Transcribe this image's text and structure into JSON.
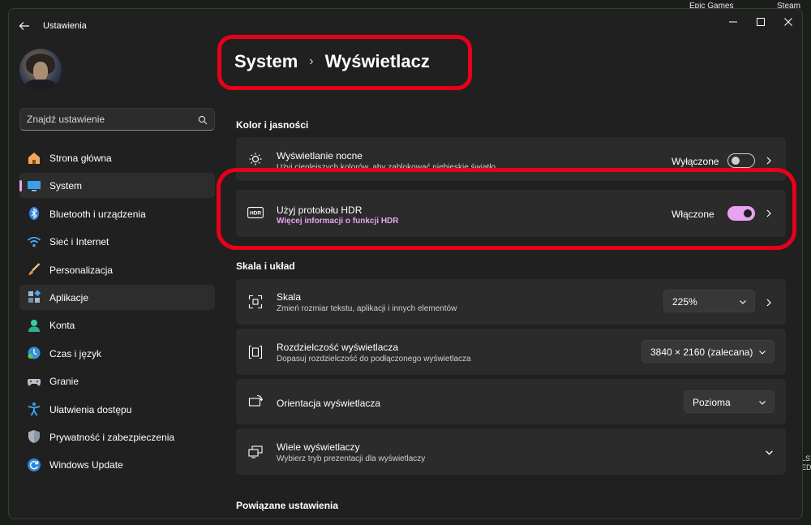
{
  "desktop": {
    "label_epic": "Epic Games",
    "label_steam": "Steam",
    "edge_text": "LSY\nED"
  },
  "window": {
    "app_title": "Ustawienia",
    "controls": {
      "minimize": "minimize-icon",
      "maximize": "maximize-icon",
      "close": "close-icon"
    }
  },
  "search": {
    "placeholder": "Znajdź ustawienie"
  },
  "sidebar": {
    "items": [
      {
        "label": "Strona główna",
        "icon": "home-icon"
      },
      {
        "label": "System",
        "icon": "monitor-icon",
        "active": true
      },
      {
        "label": "Bluetooth i urządzenia",
        "icon": "bluetooth-icon"
      },
      {
        "label": "Sieć i Internet",
        "icon": "wifi-icon"
      },
      {
        "label": "Personalizacja",
        "icon": "brush-icon"
      },
      {
        "label": "Aplikacje",
        "icon": "apps-icon",
        "hover": true
      },
      {
        "label": "Konta",
        "icon": "account-icon"
      },
      {
        "label": "Czas i język",
        "icon": "time-language-icon"
      },
      {
        "label": "Granie",
        "icon": "gamepad-icon"
      },
      {
        "label": "Ułatwienia dostępu",
        "icon": "accessibility-icon"
      },
      {
        "label": "Prywatność i zabezpieczenia",
        "icon": "shield-icon"
      },
      {
        "label": "Windows Update",
        "icon": "update-icon"
      }
    ]
  },
  "breadcrumb": {
    "parent": "System",
    "separator": "›",
    "current": "Wyświetlacz"
  },
  "sections": {
    "color": "Kolor i jasności",
    "scale": "Skala i układ",
    "related": "Powiązane ustawienia"
  },
  "cards": {
    "night_light": {
      "title": "Wyświetlanie nocne",
      "subtitle": "Użyj cieplejszych kolorów, aby zablokować niebieskie światło",
      "status": "Wyłączone",
      "toggle_on": false
    },
    "hdr": {
      "title": "Użyj protokołu HDR",
      "link": "Więcej informacji o funkcji HDR",
      "status": "Włączone",
      "toggle_on": true
    },
    "scale": {
      "title": "Skala",
      "subtitle": "Zmień rozmiar tekstu, aplikacji i innych elementów",
      "value": "225%"
    },
    "resolution": {
      "title": "Rozdzielczość wyświetlacza",
      "subtitle": "Dopasuj rozdzielczość do podłączonego wyświetlacza",
      "value": "3840 × 2160 (zalecana)"
    },
    "orientation": {
      "title": "Orientacja wyświetlacza",
      "value": "Pozioma"
    },
    "multiple": {
      "title": "Wiele wyświetlaczy",
      "subtitle": "Wybierz tryb prezentacji dla wyświetlaczy"
    }
  },
  "colors": {
    "accent": "#e8a2f0",
    "highlight_annotation": "#e8001a",
    "window_bg": "#202020",
    "card_bg": "#2b2b2b"
  }
}
